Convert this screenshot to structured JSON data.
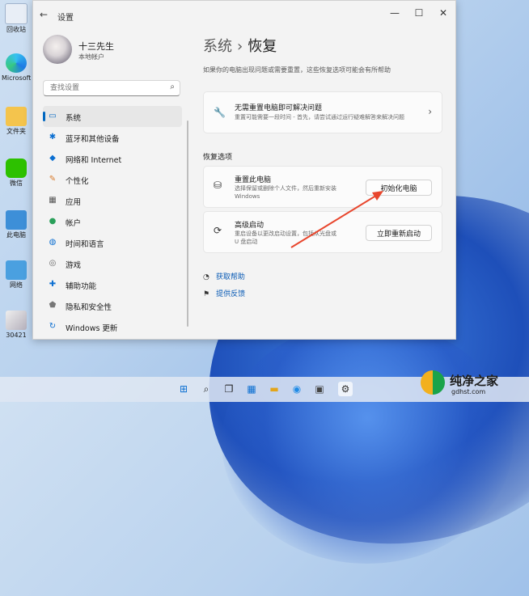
{
  "desktop": {
    "icons": [
      {
        "label": "回收站"
      },
      {
        "label": "Microsoft Edge"
      },
      {
        "label": "文件夹"
      },
      {
        "label": "微信"
      },
      {
        "label": "此电脑"
      },
      {
        "label": "网络"
      },
      {
        "label": "30421"
      }
    ]
  },
  "window": {
    "title": "设置",
    "controls": {
      "minimize": "—",
      "maximize": "☐",
      "close": "✕"
    }
  },
  "profile": {
    "name": "十三先生",
    "account_type": "本地帐户"
  },
  "search": {
    "placeholder": "查找设置"
  },
  "sidebar": {
    "items": [
      {
        "label": "系统",
        "icon": "monitor-icon",
        "active": true
      },
      {
        "label": "蓝牙和其他设备",
        "icon": "bluetooth-icon",
        "active": false
      },
      {
        "label": "网络和 Internet",
        "icon": "wifi-icon",
        "active": false
      },
      {
        "label": "个性化",
        "icon": "brush-icon",
        "active": false
      },
      {
        "label": "应用",
        "icon": "apps-icon",
        "active": false
      },
      {
        "label": "帐户",
        "icon": "person-icon",
        "active": false
      },
      {
        "label": "时间和语言",
        "icon": "globe-clock-icon",
        "active": false
      },
      {
        "label": "游戏",
        "icon": "gamepad-icon",
        "active": false
      },
      {
        "label": "辅助功能",
        "icon": "accessibility-icon",
        "active": false
      },
      {
        "label": "隐私和安全性",
        "icon": "shield-icon",
        "active": false
      },
      {
        "label": "Windows 更新",
        "icon": "update-icon",
        "active": false
      }
    ]
  },
  "content": {
    "breadcrumb_parent": "系统",
    "breadcrumb_sep": "›",
    "breadcrumb_current": "恢复",
    "description": "如果你的电脑出现问题或需要重置，这些恢复选项可能会有所帮助",
    "fix_card": {
      "title": "无需重置电脑即可解决问题",
      "subtitle": "重置可能需要一段时间 - 首先，请尝试通过运行疑难解答来解决问题"
    },
    "section_title": "恢复选项",
    "reset_card": {
      "title": "重置此电脑",
      "subtitle_line1": "选择保留或删除个人文件，然后重新安装",
      "subtitle_line2": "Windows",
      "button": "初始化电脑"
    },
    "advanced_card": {
      "title": "高级启动",
      "subtitle_line1": "重启设备以更改启动设置，包括从光盘或",
      "subtitle_line2": "U 盘启动",
      "button": "立即重新启动"
    },
    "links": [
      {
        "label": "获取帮助",
        "icon": "help-icon"
      },
      {
        "label": "提供反馈",
        "icon": "feedback-icon"
      }
    ]
  },
  "taskbar": {
    "items": [
      {
        "icon": "windows-start-icon",
        "glyph": "⊞"
      },
      {
        "icon": "search-icon",
        "glyph": "⌕"
      },
      {
        "icon": "task-view-icon",
        "glyph": "❐"
      },
      {
        "icon": "widgets-icon",
        "glyph": "▦"
      },
      {
        "icon": "file-explorer-icon",
        "glyph": "▬"
      },
      {
        "icon": "edge-icon",
        "glyph": "◉"
      },
      {
        "icon": "store-icon",
        "glyph": "▣"
      },
      {
        "icon": "settings-icon",
        "glyph": "⚙"
      }
    ]
  },
  "watermark": {
    "brand": "纯净之家",
    "url": "gdhst.com"
  },
  "colors": {
    "accent": "#0067c0",
    "annotation": "#e8462d"
  }
}
